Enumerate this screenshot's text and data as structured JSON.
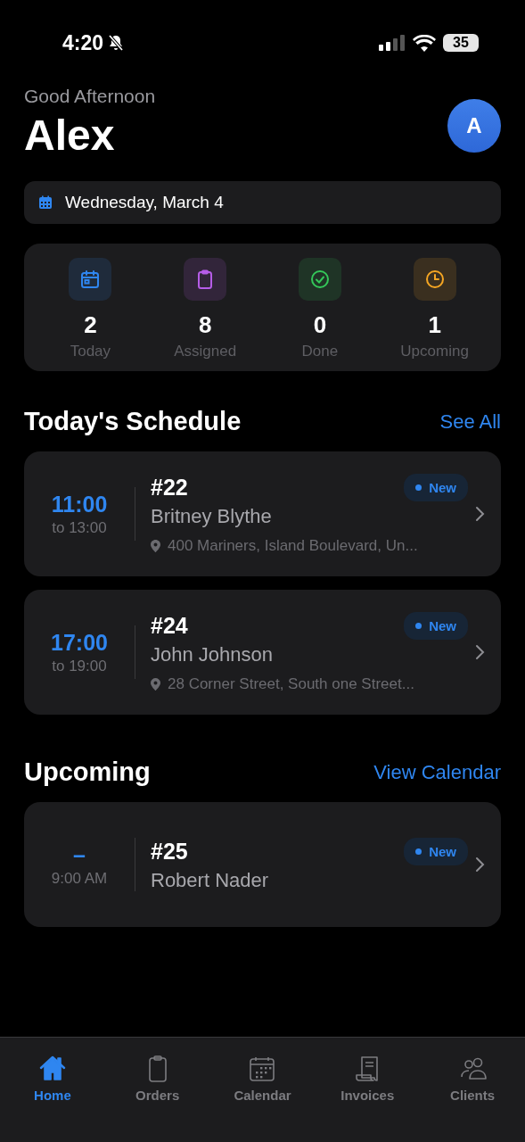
{
  "status_bar": {
    "time": "4:20",
    "battery": "35"
  },
  "header": {
    "greeting": "Good Afternoon",
    "name": "Alex",
    "avatar": "A"
  },
  "date_bar": {
    "label": "Wednesday, March 4"
  },
  "stats": [
    {
      "kind": "calendar",
      "value": "2",
      "label": "Today",
      "color": "#2f86f0"
    },
    {
      "kind": "clipboard",
      "value": "8",
      "label": "Assigned",
      "color": "#b65de8"
    },
    {
      "kind": "check",
      "value": "0",
      "label": "Done",
      "color": "#34c759"
    },
    {
      "kind": "clock",
      "value": "1",
      "label": "Upcoming",
      "color": "#f5a623"
    }
  ],
  "schedule": {
    "title": "Today's Schedule",
    "link": "See All",
    "items": [
      {
        "time": "11:00",
        "end": "to 13:00",
        "number": "#22",
        "client": "Britney Blythe",
        "badge": "New",
        "address": "400 Mariners, Island Boulevard, Un..."
      },
      {
        "time": "17:00",
        "end": "to 19:00",
        "number": "#24",
        "client": "John Johnson",
        "badge": "New",
        "address": "28 Corner Street, South one Street..."
      }
    ]
  },
  "upcoming": {
    "title": "Upcoming",
    "link": "View Calendar",
    "items": [
      {
        "time": "–",
        "end": "9:00 AM",
        "number": "#25",
        "client": "Robert Nader",
        "badge": "New"
      }
    ]
  },
  "tab_bar": [
    {
      "kind": "home",
      "label": "Home",
      "selected": true
    },
    {
      "kind": "orders",
      "label": "Orders",
      "selected": false
    },
    {
      "kind": "calendar",
      "label": "Calendar",
      "selected": false
    },
    {
      "kind": "invoices",
      "label": "Invoices",
      "selected": false
    },
    {
      "kind": "clients",
      "label": "Clients",
      "selected": false
    }
  ]
}
